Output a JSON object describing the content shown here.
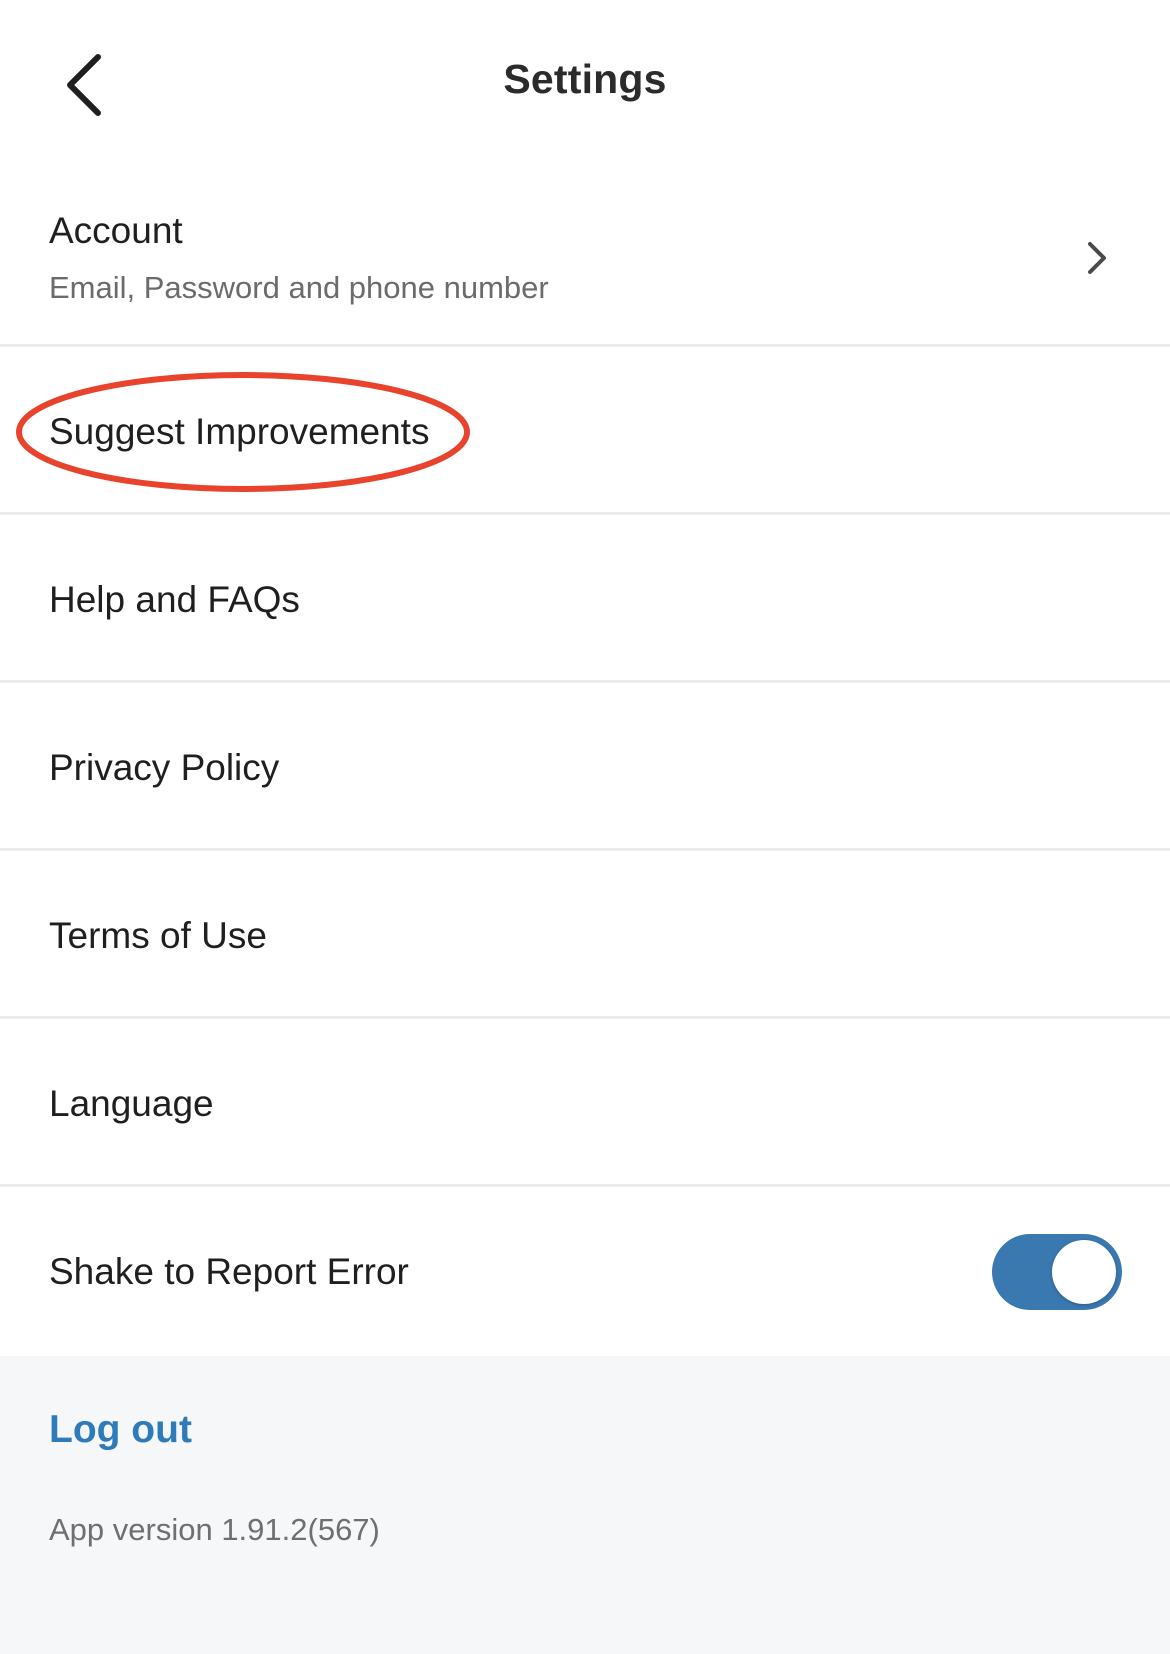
{
  "header": {
    "title": "Settings",
    "back_icon": "chevron-left-icon"
  },
  "menu": {
    "account": {
      "label": "Account",
      "sublabel": "Email, Password and phone number",
      "icon": "chevron-right-icon"
    },
    "suggest": {
      "label": "Suggest Improvements"
    },
    "help": {
      "label": "Help and FAQs"
    },
    "privacy": {
      "label": "Privacy Policy"
    },
    "terms": {
      "label": "Terms of Use"
    },
    "language": {
      "label": "Language"
    },
    "shake": {
      "label": "Shake to Report Error",
      "enabled": true
    }
  },
  "footer": {
    "logout_label": "Log out",
    "app_version": "App version 1.91.2(567)"
  },
  "colors": {
    "accent": "#2f7ab8",
    "toggle_on": "#3a78b0",
    "annotation": "#e8432d",
    "divider": "#ececec",
    "footer_bg": "#f5f7f9"
  }
}
